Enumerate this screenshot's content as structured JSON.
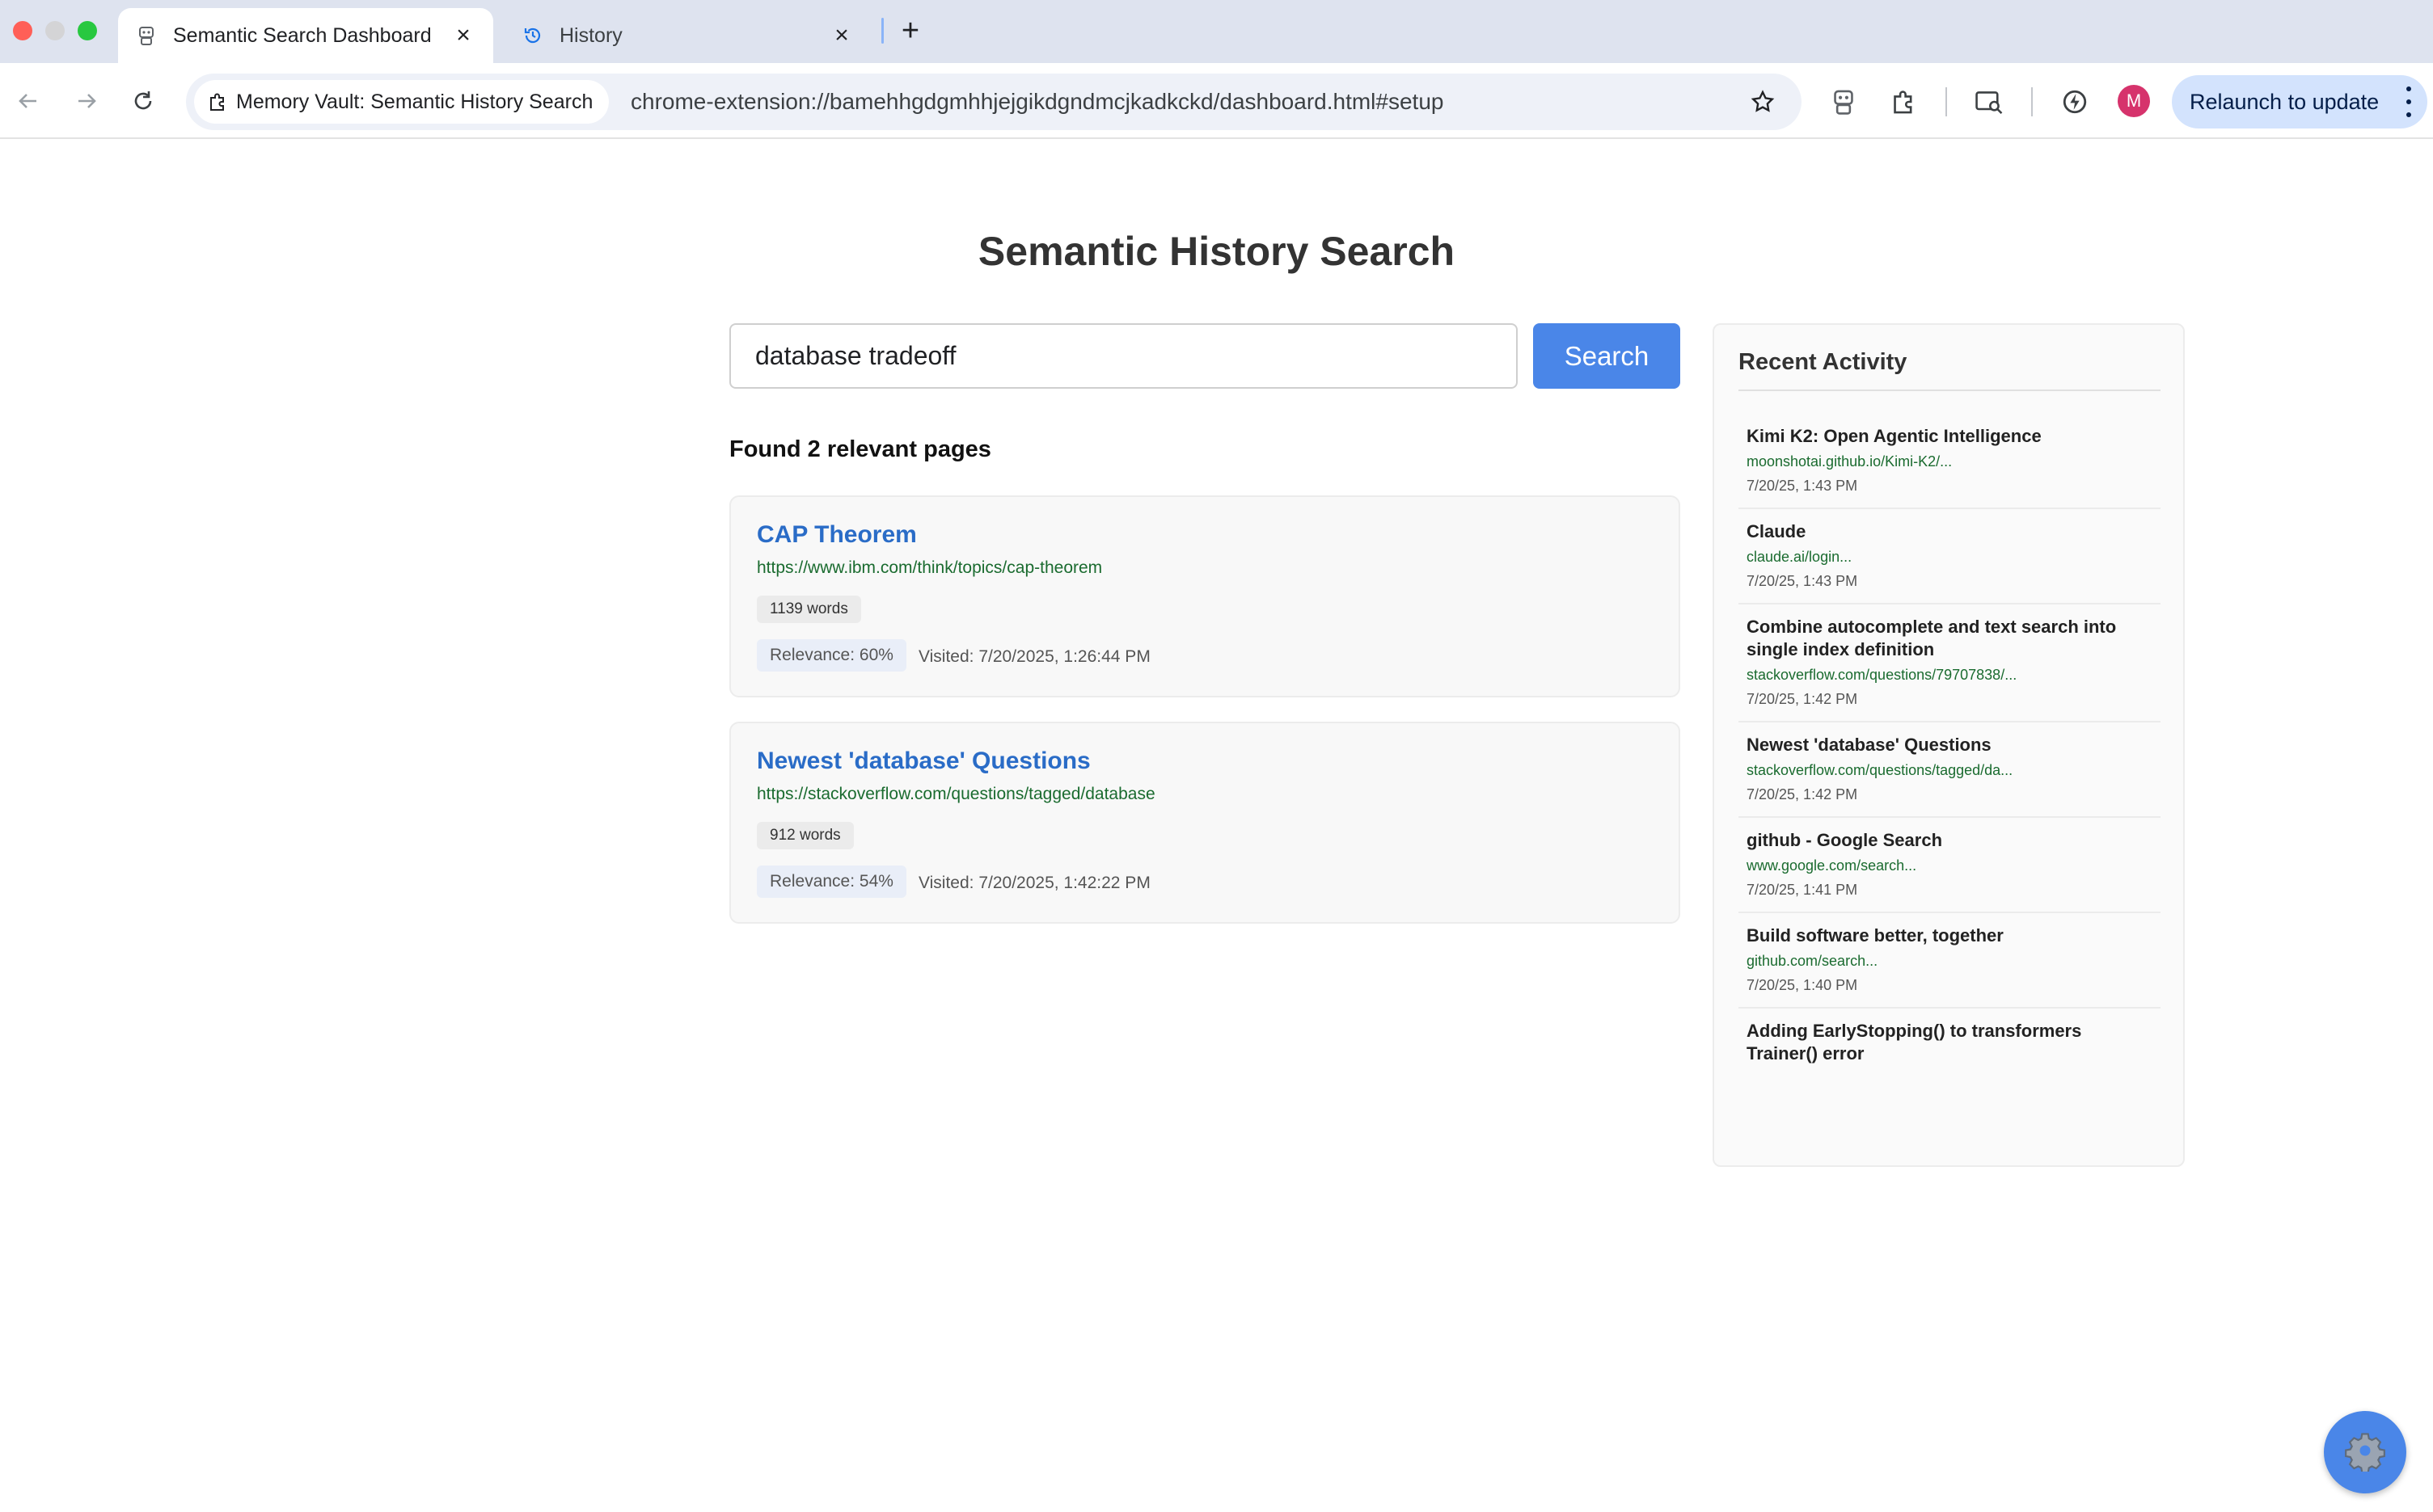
{
  "browser": {
    "tabs": [
      {
        "title": "Semantic Search Dashboard",
        "icon": "extension-robot-icon",
        "active": true
      },
      {
        "title": "History",
        "icon": "history-clock-icon",
        "active": false
      }
    ],
    "site_chip": "Memory Vault: Semantic History Search",
    "url": "chrome-extension://bamehhgdgmhhjejgikdgndmcjkadkckd/dashboard.html#setup",
    "avatar_initial": "M",
    "relaunch_label": "Relaunch to update"
  },
  "page": {
    "title": "Semantic History Search",
    "search": {
      "value": "database tradeoff",
      "button_label": "Search"
    },
    "results_summary": "Found 2 relevant pages",
    "results": [
      {
        "title": "CAP Theorem",
        "url": "https://www.ibm.com/think/topics/cap-theorem",
        "words": "1139 words",
        "relevance": "Relevance: 60%",
        "visited": "Visited: 7/20/2025, 1:26:44 PM"
      },
      {
        "title": "Newest 'database' Questions",
        "url": "https://stackoverflow.com/questions/tagged/database",
        "words": "912 words",
        "relevance": "Relevance: 54%",
        "visited": "Visited: 7/20/2025, 1:42:22 PM"
      }
    ],
    "recent_activity": {
      "title": "Recent Activity",
      "items": [
        {
          "title": "Kimi K2: Open Agentic Intelligence",
          "url": "moonshotai.github.io/Kimi-K2/...",
          "time": "7/20/25, 1:43 PM"
        },
        {
          "title": "Claude",
          "url": "claude.ai/login...",
          "time": "7/20/25, 1:43 PM"
        },
        {
          "title": "Combine autocomplete and text search into single index definition",
          "url": "stackoverflow.com/questions/79707838/...",
          "time": "7/20/25, 1:42 PM"
        },
        {
          "title": "Newest 'database' Questions",
          "url": "stackoverflow.com/questions/tagged/da...",
          "time": "7/20/25, 1:42 PM"
        },
        {
          "title": "github - Google Search",
          "url": "www.google.com/search...",
          "time": "7/20/25, 1:41 PM"
        },
        {
          "title": "Build software better, together",
          "url": "github.com/search...",
          "time": "7/20/25, 1:40 PM"
        },
        {
          "title": "Adding EarlyStopping() to transformers Trainer() error",
          "url": "",
          "time": ""
        }
      ]
    }
  },
  "colors": {
    "accent": "#4a86e8",
    "link": "#2a6cc7",
    "url_green": "#1a6b2f",
    "tabstrip": "#dee3ef"
  }
}
